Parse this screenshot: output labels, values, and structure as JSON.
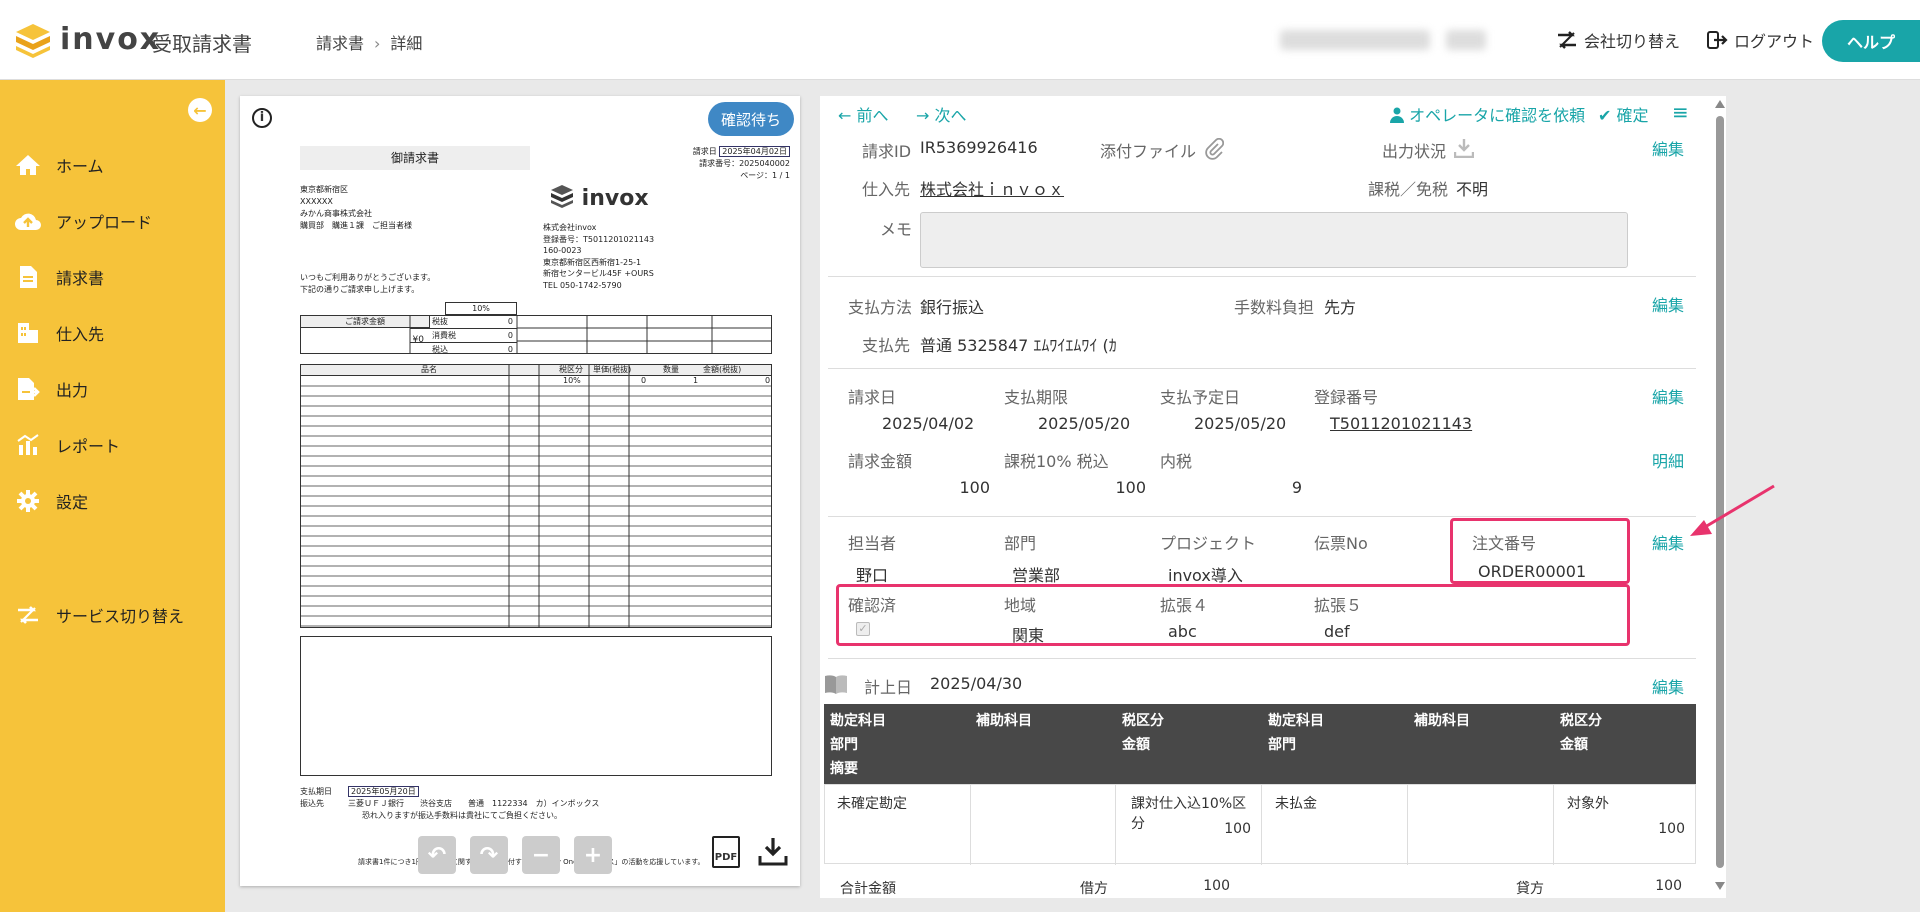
{
  "header": {
    "logo_text": "invox",
    "logo_sub": "受取請求書",
    "breadcrumb": [
      "請求書",
      "詳細"
    ],
    "switch_company_label": "会社切り替え",
    "logout_label": "ログアウト",
    "help_label": "ヘルプ"
  },
  "sidebar": {
    "items": [
      {
        "label": "ホーム",
        "icon": "home-icon"
      },
      {
        "label": "アップロード",
        "icon": "upload-icon"
      },
      {
        "label": "請求書",
        "icon": "document-icon"
      },
      {
        "label": "仕入先",
        "icon": "building-icon"
      },
      {
        "label": "出力",
        "icon": "export-icon"
      },
      {
        "label": "レポート",
        "icon": "report-icon"
      },
      {
        "label": "設定",
        "icon": "gear-icon"
      }
    ],
    "service_switch_label": "サービス切り替え"
  },
  "preview": {
    "status_badge": "確認待ち",
    "doc": {
      "title": "御請求書",
      "date_label": "請求日",
      "date_value": "2025年04月02日",
      "number_label": "請求番号：2025040002",
      "page_label": "ページ：1 / 1",
      "to_lines": [
        "東京都新宿区",
        "XXXXXX",
        "みかん商事株式会社",
        "購買部　購進１課　ご担当者様"
      ],
      "brand": "invox",
      "from_lines": [
        "株式会社invox",
        "登録番号：T5011201021143",
        "160-0023",
        "東京都新宿区西新宿1-25-1",
        "新宿センタービル45F +OURS",
        "TEL 050-1742-5790"
      ],
      "greeting": [
        "いつもご利用ありがとうございます。",
        "下記の通りご請求申し上げます。"
      ],
      "summary_label": "ご請求金額",
      "summary_value": "¥0",
      "tax_rate": "10%",
      "sub_rows": [
        {
          "label": "税抜",
          "value": "0"
        },
        {
          "label": "消費税",
          "value": "0"
        },
        {
          "label": "税込",
          "value": "0"
        }
      ],
      "item_headers": [
        "品名",
        "税区分",
        "単価(税抜)",
        "数量",
        "金額(税抜)"
      ],
      "item_first_row": [
        "",
        "10%",
        "0",
        "1",
        "0"
      ],
      "pay_label": "支払期日",
      "pay_date": "2025年05月20日",
      "bank_label": "振込先",
      "bank_line": "三菱ＵＦＪ銀行　　渋谷支店　　普通　1122334　カ）インボックス",
      "bank_note": "恐れ入りますが振込手数料は貴社にてご負担ください。",
      "footer_note": "請求書1件につき1円を子どもに関するNPOに寄付する「One by One インボイス」の活動を応援しています。"
    },
    "pdf_label": "PDF"
  },
  "detail": {
    "nav": {
      "prev": "前へ",
      "next": "次へ",
      "request_confirm": "オペレータに確認を依頼",
      "confirm": "確定"
    },
    "s1": {
      "invoice_id_label": "請求ID",
      "invoice_id": "IR5369926416",
      "attachment_label": "添付ファイル",
      "output_status_label": "出力状況",
      "vendor_label": "仕入先",
      "vendor": "株式会社ｉｎｖｏｘ",
      "tax_label": "課税／免税",
      "tax_value": "不明",
      "memo_label": "メモ",
      "edit": "編集"
    },
    "s2": {
      "method_label": "支払方法",
      "method": "銀行振込",
      "fee_label": "手数料負担",
      "fee": "先方",
      "payee_label": "支払先",
      "payee": "普通 5325847 ｴﾑﾜｲｴﾑﾜｲ (ｶ",
      "edit": "編集"
    },
    "s3": {
      "invoice_date_label": "請求日",
      "invoice_date": "2025/04/02",
      "due_label": "支払期限",
      "due": "2025/05/20",
      "planned_label": "支払予定日",
      "planned": "2025/05/20",
      "reg_label": "登録番号",
      "reg": "T5011201021143",
      "amount_label": "請求金額",
      "amount": "100",
      "taxed_label": "課税10% 税込",
      "taxed": "100",
      "inner_tax_label": "内税",
      "inner_tax": "9",
      "edit": "編集",
      "detail_link": "明細"
    },
    "s4": {
      "person_label": "担当者",
      "person": "野口",
      "dept_label": "部門",
      "dept": "営業部",
      "project_label": "プロジェクト",
      "project": "invox導入",
      "slip_label": "伝票No",
      "order_label": "注文番号",
      "order": "ORDER00001",
      "confirmed_label": "確認済",
      "region_label": "地域",
      "region": "関東",
      "ext4_label": "拡張４",
      "ext4": "abc",
      "ext5_label": "拡張５",
      "ext5": "def",
      "edit": "編集"
    },
    "s5": {
      "post_date_label": "計上日",
      "post_date": "2025/04/30",
      "edit": "編集",
      "headers": {
        "debit_account": "勘定科目",
        "debit_dept": "部門",
        "summary": "摘要",
        "debit_sub": "補助科目",
        "debit_tax": "税区分",
        "debit_amount": "金額",
        "credit_account": "勘定科目",
        "credit_dept": "部門",
        "credit_sub": "補助科目",
        "credit_tax": "税区分",
        "credit_amount": "金額"
      },
      "row": {
        "debit_account": "未確定勘定",
        "debit_tax": "課対仕入込10%区分",
        "debit_amount": "100",
        "credit_account": "未払金",
        "credit_tax": "対象外",
        "credit_amount": "100"
      },
      "total_label": "合計金額",
      "debit_label": "借方",
      "debit_total": "100",
      "credit_label": "貸方",
      "credit_total": "100"
    }
  },
  "colors": {
    "accent": "#19a5a8",
    "sidebar": "#f6c33a",
    "highlight": "#e8336d",
    "badge": "#3f88c5"
  }
}
